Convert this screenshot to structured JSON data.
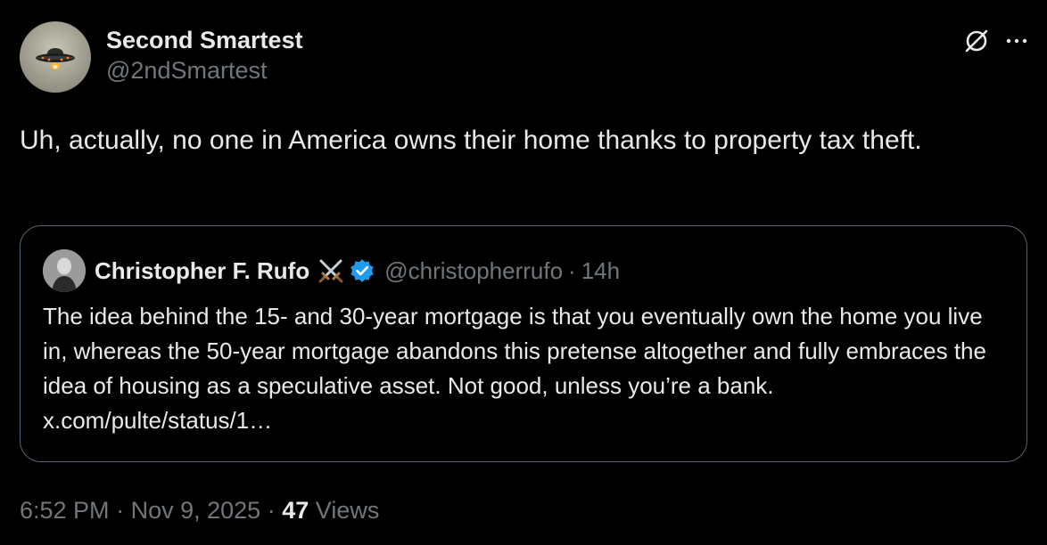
{
  "author": {
    "display_name": "Second Smartest",
    "handle": "@2ndSmartest",
    "avatar_icon": "ufo-avatar"
  },
  "top_actions": {
    "grok_icon": "grok-icon",
    "more_icon": "more-icon"
  },
  "tweet": {
    "text": "Uh, actually, no one in America owns their home thanks to property tax theft."
  },
  "quoted_tweet": {
    "display_name": "Christopher F. Rufo",
    "name_emoji": "crossed-swords-icon",
    "verified_icon": "verified-badge-icon",
    "handle": "@christopherrufo",
    "separator": "·",
    "time": "14h",
    "text": "The idea behind the 15- and 30-year mortgage is that you eventually own the home you live in, whereas the 50-year mortgage abandons this pretense altogether and fully embraces the idea of housing as a speculative asset. Not good, unless you’re a bank. x.com/pulte/status/1…"
  },
  "meta": {
    "time": "6:52 PM",
    "separator": "·",
    "date": "Nov 9, 2025",
    "views_count": "47",
    "views_label": "Views"
  },
  "colors": {
    "background": "#000000",
    "primary_text": "#e7e9ea",
    "secondary_text": "#71767b",
    "border": "#536471",
    "verified": "#1d9bf0"
  }
}
